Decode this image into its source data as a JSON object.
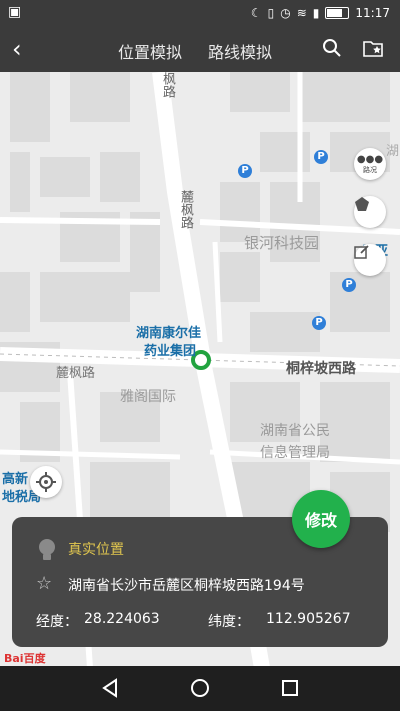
{
  "status_bar": {
    "left_icon": "image-icon",
    "time": "11:17"
  },
  "top_bar": {
    "back_icon": "back-arrow-icon",
    "tab_location": "位置模拟",
    "tab_route": "路线模拟",
    "search_icon": "search-icon",
    "favorites_icon": "star-folder-icon"
  },
  "map": {
    "labels": {
      "lufeng_road_vertical_top": "枫路",
      "lufeng_road_vertical": "麓枫路",
      "yinhe": "银河科技园",
      "hunan_kangerjia": "湖南康尔佳",
      "yaoye_jituan": "药业集团",
      "tongzipo_xilu": "桐梓坡西路",
      "lufeng_lu": "麓枫路",
      "yage": "雅阁国际",
      "hunan_gongmin_1": "湖南省公民",
      "hunan_gongmin_2": "信息管理局",
      "gaoxin_1": "高新",
      "gaoxin_2": "地税局",
      "tianya": "天亚",
      "hu_edge": "湖",
      "traffic_label": "路况"
    },
    "parking_letter": "P",
    "controls": [
      "traffic-icon",
      "pentagon-icon",
      "edit-icon"
    ]
  },
  "info_card": {
    "title": "真实位置",
    "address": "湖南省长沙市岳麓区桐梓坡西路194号",
    "longitude_label": "经度：",
    "longitude": "28.224063",
    "latitude_label": "纬度：",
    "latitude": "112.905267",
    "modify_button": "修改"
  },
  "baidu_logo": "Bai百度",
  "nav_bar": [
    "back-triangle-icon",
    "home-circle-icon",
    "recent-square-icon"
  ]
}
